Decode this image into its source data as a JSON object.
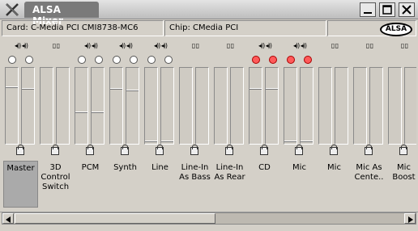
{
  "window": {
    "title": "ALSA Mixer"
  },
  "info": {
    "card": "Card: C-Media PCI CMI8738-MC6",
    "chip": "Chip: CMedia PCI",
    "logo": "ALSA"
  },
  "icons": {
    "app": "x-logo-icon",
    "minimize": "minimize-icon",
    "maximize": "maximize-icon",
    "close": "close-icon",
    "volume": "speaker-icon",
    "lock": "lock-icon"
  },
  "channels": [
    {
      "label": "Master",
      "leds": [
        false,
        false
      ],
      "levels": [
        0.75,
        0.72
      ],
      "selected": true
    },
    {
      "label": "3D Control Switch",
      "leds": [],
      "levels": [],
      "selected": false
    },
    {
      "label": "PCM",
      "leds": [
        false,
        false
      ],
      "levels": [
        0.4,
        0.4
      ],
      "selected": false
    },
    {
      "label": "Synth",
      "leds": [
        false,
        false
      ],
      "levels": [
        0.72,
        0.7
      ],
      "selected": false
    },
    {
      "label": "Line",
      "leds": [
        false,
        false
      ],
      "levels": [
        0.0,
        0.0
      ],
      "selected": false
    },
    {
      "label": "Line-In As Bass",
      "leds": [],
      "levels": [],
      "selected": false
    },
    {
      "label": "Line-In As Rear",
      "leds": [],
      "levels": [],
      "selected": false
    },
    {
      "label": "CD",
      "leds": [
        true,
        true
      ],
      "levels": [
        0.72,
        0.72
      ],
      "selected": false
    },
    {
      "label": "Mic",
      "leds": [
        true,
        true
      ],
      "levels": [
        0.0,
        0.0
      ],
      "selected": false
    },
    {
      "label": "Mic",
      "leds": [],
      "levels": [],
      "selected": false
    },
    {
      "label": "Mic As Cente..",
      "leds": [],
      "levels": [],
      "selected": false
    },
    {
      "label": "Mic Boost",
      "leds": [],
      "levels": [],
      "selected": false
    }
  ]
}
